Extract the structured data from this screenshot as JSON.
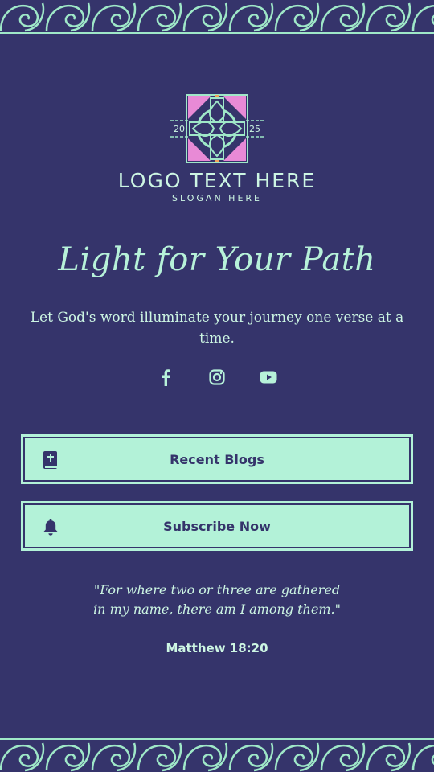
{
  "brand": {
    "logo_year_left": "20",
    "logo_year_right": "25",
    "logo_text": "LOGO TEXT HERE",
    "slogan": "SLOGAN HERE"
  },
  "hero": {
    "headline": "Light for Your Path",
    "tagline": "Let God's word illuminate your journey one verse at a time."
  },
  "socials": [
    {
      "name": "facebook",
      "icon": "facebook-icon"
    },
    {
      "name": "instagram",
      "icon": "instagram-icon"
    },
    {
      "name": "youtube",
      "icon": "youtube-icon"
    }
  ],
  "buttons": {
    "recent_blogs": {
      "label": "Recent Blogs",
      "icon": "bible-icon"
    },
    "subscribe": {
      "label": "Subscribe Now",
      "icon": "bell-icon"
    }
  },
  "verse": {
    "line1": "\"For where two or three are gathered",
    "line2": "in my name, there am I among them.\"",
    "citation": "Matthew 18:20"
  },
  "colors": {
    "background": "#35346b",
    "accent": "#b3f2d8",
    "button_text": "#35346b",
    "logo_pink": "#e88ad6",
    "logo_orange": "#f3a35a"
  }
}
